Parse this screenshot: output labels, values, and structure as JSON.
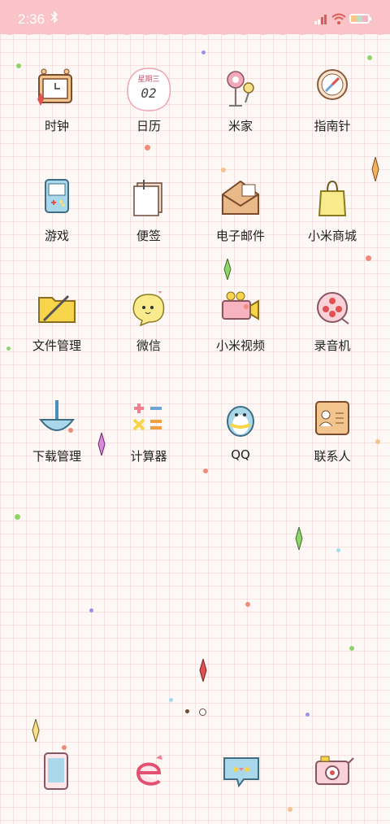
{
  "status_bar": {
    "time": "2:36"
  },
  "apps": [
    {
      "id": "clock",
      "label": "时钟"
    },
    {
      "id": "calendar",
      "label": "日历",
      "icon_text_top": "星期三",
      "icon_text_day": "02"
    },
    {
      "id": "mijia",
      "label": "米家"
    },
    {
      "id": "compass",
      "label": "指南针"
    },
    {
      "id": "games",
      "label": "游戏"
    },
    {
      "id": "notes",
      "label": "便签"
    },
    {
      "id": "email",
      "label": "电子邮件"
    },
    {
      "id": "mall",
      "label": "小米商城"
    },
    {
      "id": "files",
      "label": "文件管理"
    },
    {
      "id": "wechat",
      "label": "微信"
    },
    {
      "id": "mivideo",
      "label": "小米视频"
    },
    {
      "id": "recorder",
      "label": "录音机"
    },
    {
      "id": "downloads",
      "label": "下载管理"
    },
    {
      "id": "calculator",
      "label": "计算器"
    },
    {
      "id": "qq",
      "label": "QQ"
    },
    {
      "id": "contacts",
      "label": "联系人"
    }
  ],
  "dock": [
    "phone-icon",
    "browser-icon",
    "messages-icon",
    "camera-icon"
  ],
  "theme": {
    "status_bar": "#f9c3c8",
    "grid_line": "#e8c8c8",
    "background": "#fdf7f5"
  }
}
